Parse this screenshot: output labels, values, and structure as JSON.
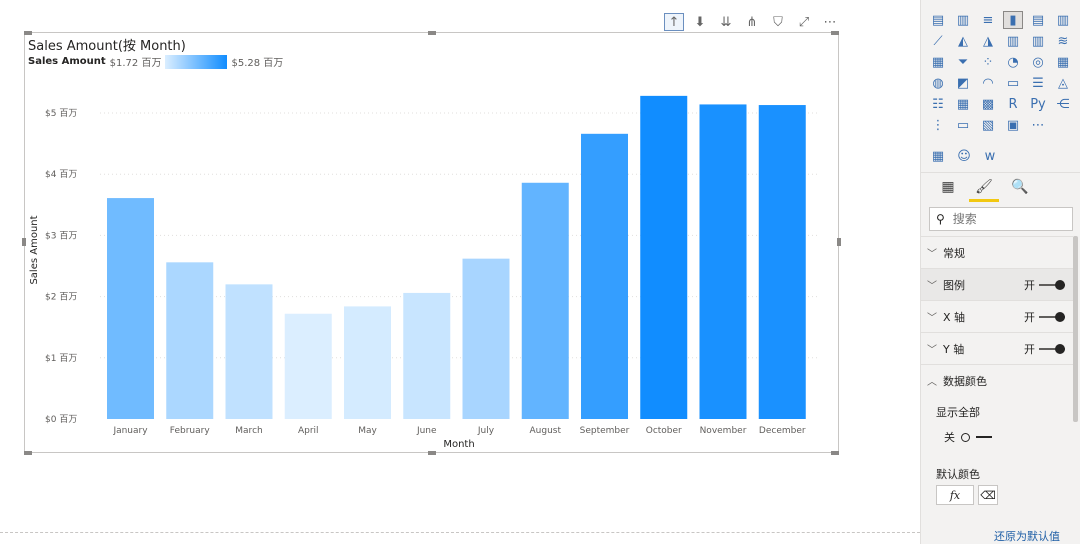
{
  "visual_toolbar": {
    "icons": [
      "drill-up-icon",
      "drill-down-toggle-icon",
      "expand-all-icon",
      "expand-hierarchy-icon",
      "filter-icon",
      "focus-mode-icon",
      "more-options-icon"
    ],
    "glyphs": [
      "↑",
      "⬇",
      "⇊",
      "⋔",
      "⛉",
      "⤢",
      "⋯"
    ]
  },
  "chart": {
    "title": "Sales Amount(按 Month)",
    "legend": {
      "name": "Sales Amount",
      "min_label": "$1.72 百万",
      "max_label": "$5.28 百万"
    }
  },
  "chart_data": {
    "type": "bar",
    "title": "Sales Amount(按 Month)",
    "xlabel": "Month",
    "ylabel": "Sales Amount",
    "ylim": [
      0,
      5.28
    ],
    "grid": true,
    "legend": "top-left",
    "color_scale": {
      "min": 1.72,
      "max": 5.28,
      "min_color": "#dbeeff",
      "max_color": "#118dff"
    },
    "y_ticks": [
      {
        "value": 0,
        "label": "$0 百万"
      },
      {
        "value": 1,
        "label": "$1 百万"
      },
      {
        "value": 2,
        "label": "$2 百万"
      },
      {
        "value": 3,
        "label": "$3 百万"
      },
      {
        "value": 4,
        "label": "$4 百万"
      },
      {
        "value": 5,
        "label": "$5 百万"
      }
    ],
    "categories": [
      "January",
      "February",
      "March",
      "April",
      "May",
      "June",
      "July",
      "August",
      "September",
      "October",
      "November",
      "December"
    ],
    "values": [
      3.61,
      2.56,
      2.2,
      1.72,
      1.84,
      2.06,
      2.62,
      3.86,
      4.66,
      5.28,
      5.14,
      5.13
    ]
  },
  "pane": {
    "viz_icons": [
      "stacked-bar-icon",
      "stacked-column-icon",
      "clustered-bar-icon",
      "clustered-column-icon",
      "100-stacked-bar-icon",
      "100-stacked-column-icon",
      "line-chart-icon",
      "area-chart-icon",
      "stacked-area-icon",
      "line-clustered-column-icon",
      "line-stacked-column-icon",
      "ribbon-chart-icon",
      "waterfall-icon",
      "funnel-icon",
      "scatter-icon",
      "pie-icon",
      "donut-icon",
      "treemap-icon",
      "map-icon",
      "filled-map-icon",
      "gauge-icon",
      "card-icon",
      "multi-row-card-icon",
      "kpi-icon",
      "slicer-icon",
      "table-icon",
      "matrix-icon",
      "r-visual-icon",
      "python-visual-icon",
      "key-influencers-icon",
      "decomposition-tree-icon",
      "qa-icon",
      "smart-narrative-icon",
      "paginated-report-icon",
      "more-visuals-icon"
    ],
    "viz_glyphs": [
      "▤",
      "▥",
      "≡",
      "▮",
      "▤",
      "▥",
      "⟋",
      "◭",
      "◮",
      "▥",
      "▥",
      "≋",
      "▦",
      "⏷",
      "⁘",
      "◔",
      "◎",
      "▦",
      "◍",
      "◩",
      "◠",
      "▭",
      "☰",
      "◬",
      "☷",
      "▦",
      "▩",
      "R",
      "Py",
      "⋲",
      "⋮",
      "▭",
      "▧",
      "▣",
      "⋯"
    ],
    "custom_icons": [
      "custom-visual-icon",
      "person-visual-icon",
      "word-cloud-icon"
    ],
    "custom_glyphs": [
      "▦",
      "☺",
      "w"
    ],
    "tabs": [
      "fields-tab",
      "format-tab",
      "analytics-tab"
    ],
    "tab_glyphs": [
      "▦",
      "🖌",
      "🔍"
    ],
    "search_placeholder": "搜索",
    "sections": [
      {
        "label": "常规",
        "expanded": false
      },
      {
        "label": "图例",
        "expanded": false,
        "toggle": "开"
      },
      {
        "label": "X 轴",
        "expanded": false,
        "toggle": "开"
      },
      {
        "label": "Y 轴",
        "expanded": false,
        "toggle": "开"
      },
      {
        "label": "数据颜色",
        "expanded": true
      }
    ],
    "show_all_label": "显示全部",
    "show_all_state": "关",
    "default_color_label": "默认颜色",
    "fx_label": "fx",
    "revert_label": "还原为默认值"
  }
}
